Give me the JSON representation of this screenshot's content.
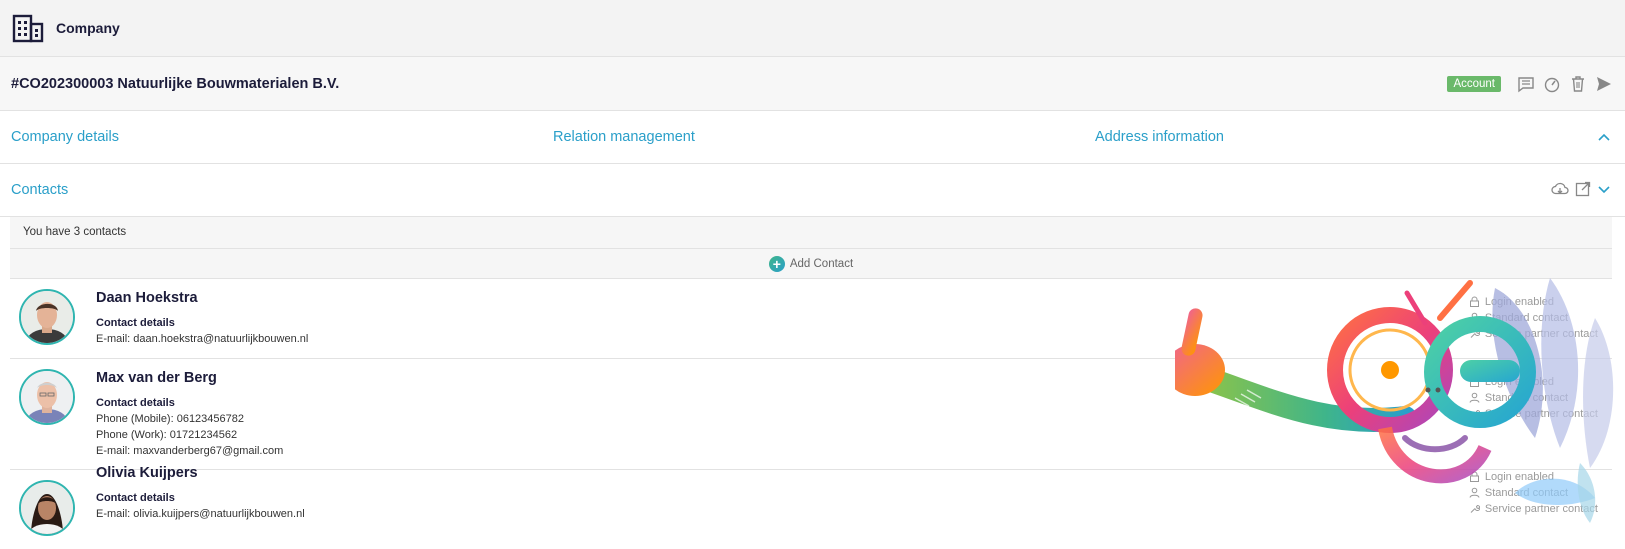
{
  "header": {
    "title": "Company",
    "icon": "building-icon"
  },
  "record": {
    "title": "#CO202300003 Natuurlijke Bouwmaterialen B.V.",
    "badge": "Account",
    "badge_color": "#6ab96a",
    "actions": [
      "comment-icon",
      "dashboard-icon",
      "trash-icon",
      "send-icon"
    ]
  },
  "tabs": [
    {
      "label": "Company details"
    },
    {
      "label": "Relation management"
    },
    {
      "label": "Address information"
    }
  ],
  "contacts_section": {
    "label": "Contacts",
    "summary": "You have 3 contacts",
    "add_label": "Add Contact",
    "tools": [
      "cloud-download-icon",
      "external-link-icon",
      "chevron-down-icon"
    ]
  },
  "contacts": [
    {
      "name": "Daan Hoekstra",
      "details_label": "Contact details",
      "lines": [
        "E-mail: daan.hoekstra@natuurlijkbouwen.nl"
      ],
      "status": [
        "Login enabled",
        "Standard contact",
        "Service partner contact"
      ]
    },
    {
      "name": "Max van der Berg",
      "details_label": "Contact details",
      "lines": [
        "Phone (Mobile): 06123456782",
        "Phone (Work): 01721234562",
        "E-mail: maxvanderberg67@gmail.com"
      ],
      "status": [
        "Login enabled",
        "Standard contact",
        "Service partner contact"
      ]
    },
    {
      "name": "Olivia Kuijpers",
      "details_label": "Contact details",
      "lines": [
        "E-mail: olivia.kuijpers@natuurlijkbouwen.nl"
      ],
      "status": [
        "Login enabled",
        "Standard contact",
        "Service partner contact"
      ]
    }
  ],
  "colors": {
    "accent": "#2a9fc9",
    "text": "#1c1c3a",
    "avatar_ring": "#2fb5b0"
  }
}
